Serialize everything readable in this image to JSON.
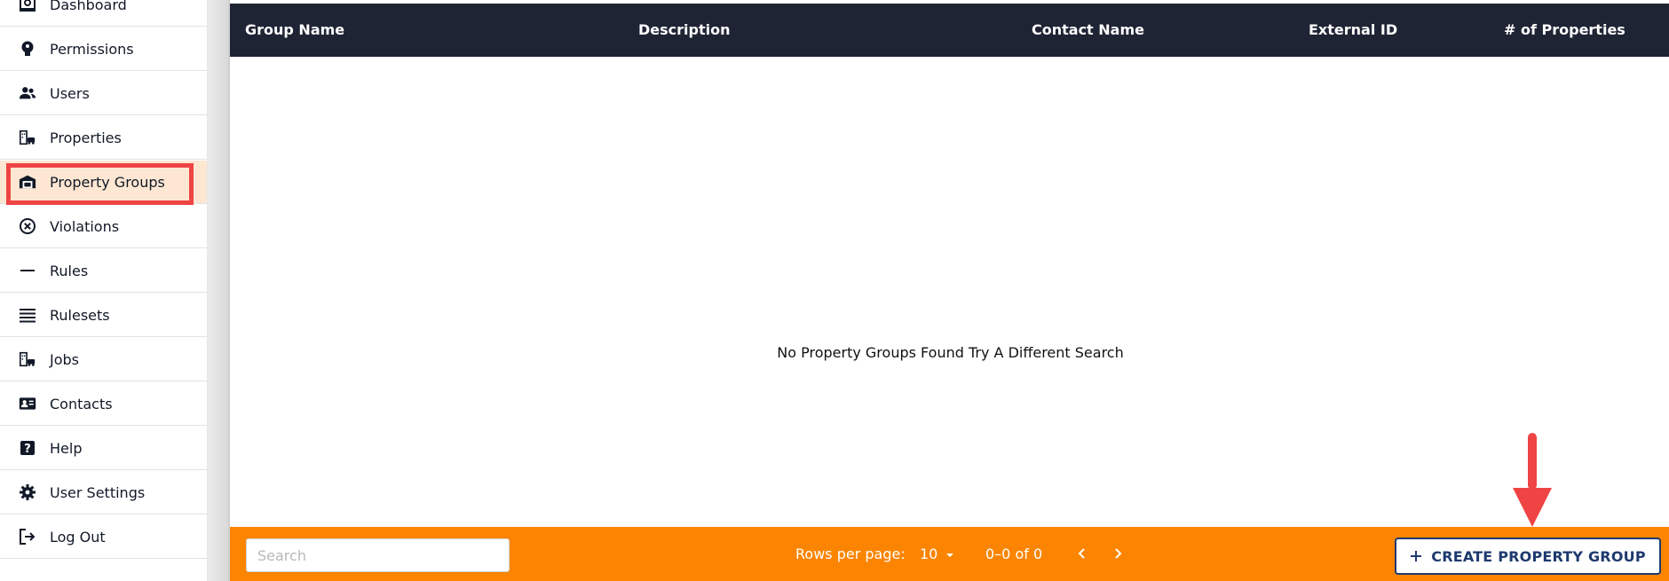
{
  "sidebar": {
    "items": [
      {
        "label": "Dashboard",
        "icon": "dashboard-icon"
      },
      {
        "label": "Permissions",
        "icon": "permissions-icon"
      },
      {
        "label": "Users",
        "icon": "users-icon"
      },
      {
        "label": "Properties",
        "icon": "properties-icon"
      },
      {
        "label": "Property Groups",
        "icon": "property-groups-icon"
      },
      {
        "label": "Violations",
        "icon": "violations-icon"
      },
      {
        "label": "Rules",
        "icon": "rules-icon"
      },
      {
        "label": "Rulesets",
        "icon": "rulesets-icon"
      },
      {
        "label": "Jobs",
        "icon": "jobs-icon"
      },
      {
        "label": "Contacts",
        "icon": "contacts-icon"
      },
      {
        "label": "Help",
        "icon": "help-icon"
      },
      {
        "label": "User Settings",
        "icon": "settings-icon"
      },
      {
        "label": "Log Out",
        "icon": "logout-icon"
      }
    ],
    "active_item": "Property Groups"
  },
  "table": {
    "columns": [
      "Group Name",
      "Description",
      "Contact Name",
      "External ID",
      "# of Properties"
    ],
    "empty_message": "No Property Groups Found Try A Different Search"
  },
  "footer": {
    "search_placeholder": "Search",
    "rows_per_page_label": "Rows per page:",
    "rows_per_page_value": "10",
    "range_text": "0–0 of 0",
    "create_button_label": "CREATE PROPERTY GROUP"
  },
  "colors": {
    "header_bg": "#1f2435",
    "footer_bg": "#fb8500",
    "highlight": "#ef4444",
    "active_bg": "#fde7d2",
    "button_text": "#1e3a6e"
  }
}
